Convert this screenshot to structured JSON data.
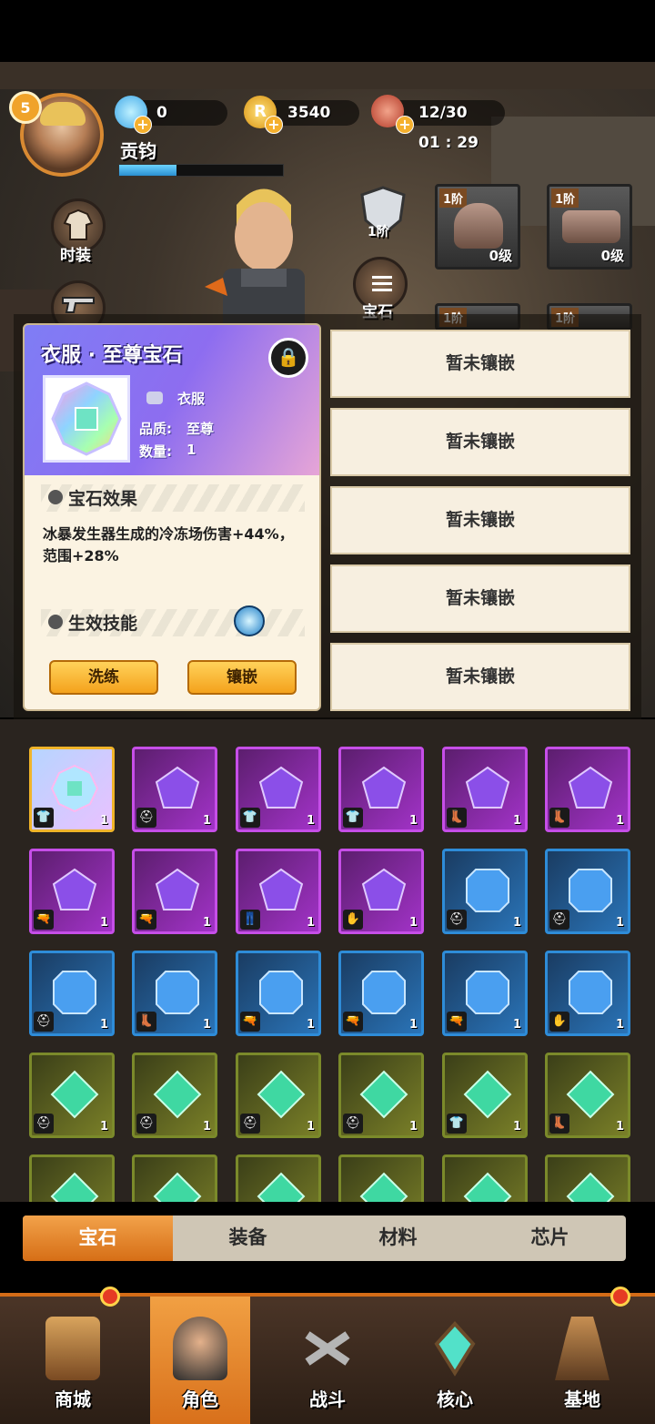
{
  "player": {
    "level": "5",
    "name": "贡钧",
    "xp_fraction": 0.35
  },
  "resources": {
    "diamond": "0",
    "coin": "3540",
    "stamina": "12/30",
    "timer": "01 : 29"
  },
  "side_buttons": {
    "costume": "时装",
    "gem": "宝石",
    "helmet_tier": "1阶"
  },
  "equipment": [
    {
      "tier": "1阶",
      "level": "0级",
      "icon": "helmet-icon"
    },
    {
      "tier": "1阶",
      "level": "0级",
      "icon": "gauntlet-icon"
    },
    {
      "tier": "1阶",
      "level": "",
      "icon": "armor-icon"
    },
    {
      "tier": "1阶",
      "level": "",
      "icon": "boots-icon"
    }
  ],
  "gem_card": {
    "title": "衣服 · 至尊宝石",
    "slot": "衣服",
    "quality_label": "品质:",
    "quality": "至尊",
    "quantity_label": "数量:",
    "quantity": "1",
    "effect_header": "宝石效果",
    "effect_text": "冰暴发生器生成的冷冻场伤害+44%，范围+28%",
    "skill_header": "生效技能",
    "reroll_button": "洗练",
    "inlay_button": "镶嵌"
  },
  "sockets": [
    "暂未镶嵌",
    "暂未镶嵌",
    "暂未镶嵌",
    "暂未镶嵌",
    "暂未镶嵌"
  ],
  "inventory": [
    {
      "type": "supreme",
      "count": "1",
      "slot": "clothes"
    },
    {
      "type": "purple",
      "count": "1",
      "slot": "helmet"
    },
    {
      "type": "purple",
      "count": "1",
      "slot": "clothes"
    },
    {
      "type": "purple",
      "count": "1",
      "slot": "clothes"
    },
    {
      "type": "purple",
      "count": "1",
      "slot": "boots"
    },
    {
      "type": "purple",
      "count": "1",
      "slot": "boots"
    },
    {
      "type": "purple",
      "count": "1",
      "slot": "gun"
    },
    {
      "type": "purple",
      "count": "1",
      "slot": "gun"
    },
    {
      "type": "purple",
      "count": "1",
      "slot": "pants"
    },
    {
      "type": "purple",
      "count": "1",
      "slot": "glove"
    },
    {
      "type": "blue",
      "count": "1",
      "slot": "helmet"
    },
    {
      "type": "blue",
      "count": "1",
      "slot": "helmet"
    },
    {
      "type": "blue",
      "count": "1",
      "slot": "helmet"
    },
    {
      "type": "blue",
      "count": "1",
      "slot": "boots"
    },
    {
      "type": "blue",
      "count": "1",
      "slot": "gun"
    },
    {
      "type": "blue",
      "count": "1",
      "slot": "gun"
    },
    {
      "type": "blue",
      "count": "1",
      "slot": "gun"
    },
    {
      "type": "blue",
      "count": "1",
      "slot": "glove"
    },
    {
      "type": "green",
      "count": "1",
      "slot": "helmet"
    },
    {
      "type": "green",
      "count": "1",
      "slot": "helmet"
    },
    {
      "type": "green",
      "count": "1",
      "slot": "helmet"
    },
    {
      "type": "green",
      "count": "1",
      "slot": "helmet"
    },
    {
      "type": "green",
      "count": "1",
      "slot": "clothes"
    },
    {
      "type": "green",
      "count": "1",
      "slot": "boots"
    },
    {
      "type": "green",
      "count": "",
      "slot": ""
    },
    {
      "type": "green",
      "count": "",
      "slot": ""
    },
    {
      "type": "green",
      "count": "",
      "slot": ""
    },
    {
      "type": "green",
      "count": "",
      "slot": ""
    },
    {
      "type": "green",
      "count": "",
      "slot": ""
    },
    {
      "type": "green",
      "count": "",
      "slot": ""
    }
  ],
  "tabs": [
    "宝石",
    "装备",
    "材料",
    "芯片"
  ],
  "nav": [
    "商城",
    "角色",
    "战斗",
    "核心",
    "基地"
  ]
}
